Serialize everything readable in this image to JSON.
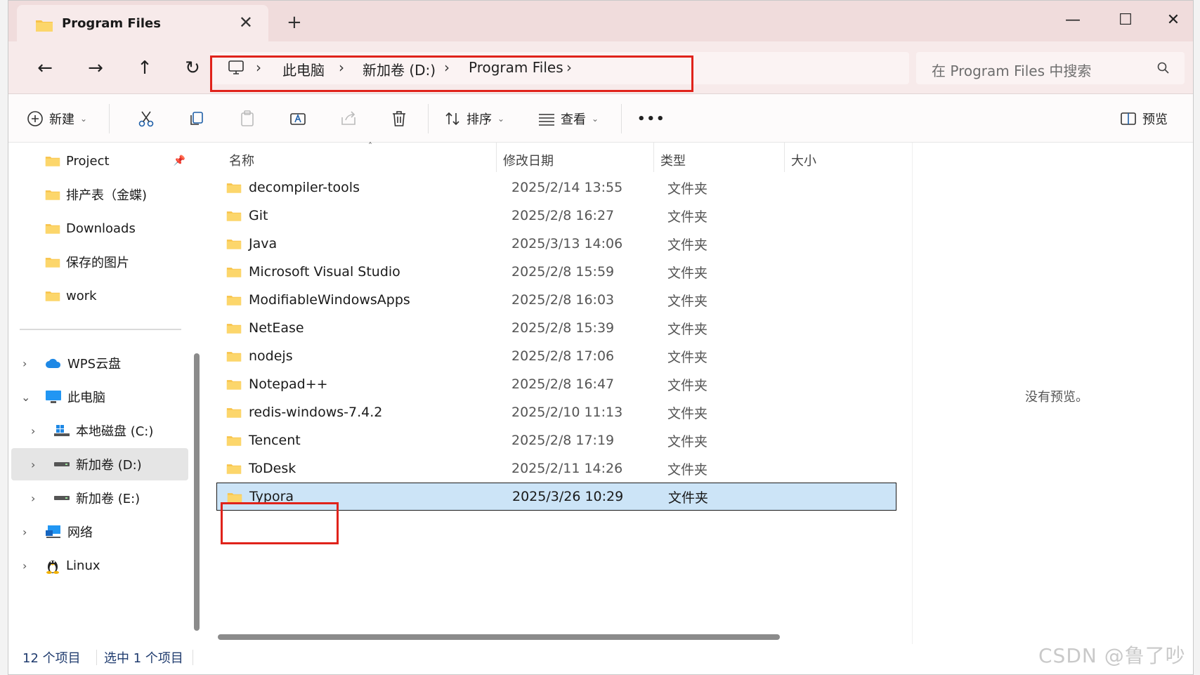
{
  "window": {
    "tab_title": "Program Files",
    "new_tab": "+",
    "controls": {
      "minimize": "—",
      "maximize": "☐",
      "close": "✕"
    }
  },
  "nav": {
    "back": "←",
    "forward": "→",
    "up": "↑",
    "refresh": "↻",
    "breadcrumb": [
      "此电脑",
      "新加卷 (D:)",
      "Program Files"
    ],
    "separator": "›",
    "search_placeholder": "在 Program Files 中搜索"
  },
  "toolbar": {
    "new_label": "新建",
    "sort_label": "排序",
    "view_label": "查看",
    "more_label": "•••",
    "preview_label": "预览"
  },
  "sidebar": {
    "quick": [
      {
        "label": "Project",
        "pinned": true
      },
      {
        "label": "排产表（金蝶)"
      },
      {
        "label": "Downloads"
      },
      {
        "label": "保存的图片"
      },
      {
        "label": "work"
      }
    ],
    "tree": [
      {
        "label": "WPS云盘",
        "expanded": false,
        "icon": "cloud-icon"
      },
      {
        "label": "此电脑",
        "expanded": true,
        "icon": "computer-icon"
      },
      {
        "label": "本地磁盘 (C:)",
        "icon": "windows-drive-icon"
      },
      {
        "label": "新加卷 (D:)",
        "icon": "drive-icon",
        "selected": true
      },
      {
        "label": "新加卷 (E:)",
        "icon": "drive-icon"
      },
      {
        "label": "网络",
        "icon": "network-icon"
      },
      {
        "label": "Linux",
        "icon": "linux-icon"
      }
    ]
  },
  "columns": {
    "name": "名称",
    "date": "修改日期",
    "type": "类型",
    "size": "大小"
  },
  "files": [
    {
      "name": "decompiler-tools",
      "date": "2025/2/14 13:55",
      "type": "文件夹"
    },
    {
      "name": "Git",
      "date": "2025/2/8 16:27",
      "type": "文件夹"
    },
    {
      "name": "Java",
      "date": "2025/3/13 14:06",
      "type": "文件夹"
    },
    {
      "name": "Microsoft Visual Studio",
      "date": "2025/2/8 15:59",
      "type": "文件夹"
    },
    {
      "name": "ModifiableWindowsApps",
      "date": "2025/2/8 16:03",
      "type": "文件夹"
    },
    {
      "name": "NetEase",
      "date": "2025/2/8 15:39",
      "type": "文件夹"
    },
    {
      "name": "nodejs",
      "date": "2025/2/8 17:06",
      "type": "文件夹"
    },
    {
      "name": "Notepad++",
      "date": "2025/2/8 16:47",
      "type": "文件夹"
    },
    {
      "name": "redis-windows-7.4.2",
      "date": "2025/2/10 11:13",
      "type": "文件夹"
    },
    {
      "name": "Tencent",
      "date": "2025/2/8 17:19",
      "type": "文件夹"
    },
    {
      "name": "ToDesk",
      "date": "2025/2/11 14:26",
      "type": "文件夹"
    },
    {
      "name": "Typora",
      "date": "2025/3/26 10:29",
      "type": "文件夹",
      "selected": true
    }
  ],
  "preview": {
    "empty_text": "没有预览。"
  },
  "status": {
    "count": "12 个项目",
    "selected": "选中 1 个项目"
  },
  "watermark": "CSDN @鲁了吵",
  "colors": {
    "highlight": "#e0231b",
    "selection": "#cce4f7",
    "folder": "#f8c34a",
    "titlebar": "#f0dcdc"
  }
}
